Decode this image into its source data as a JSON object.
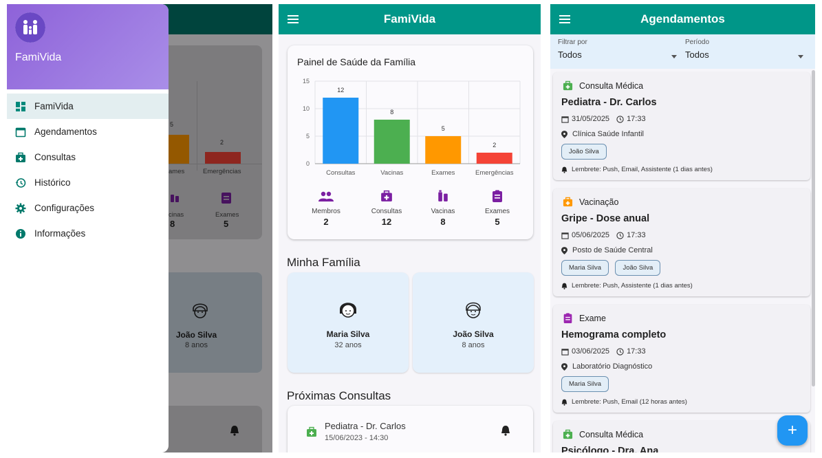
{
  "screen1": {
    "drawer": {
      "title": "FamiVida",
      "items": [
        {
          "label": "FamiVida",
          "icon": "dashboard-icon",
          "active": true
        },
        {
          "label": "Agendamentos",
          "icon": "calendar-icon"
        },
        {
          "label": "Consultas",
          "icon": "medical-bag-icon"
        },
        {
          "label": "Histórico",
          "icon": "history-icon"
        },
        {
          "label": "Configurações",
          "icon": "gear-icon"
        },
        {
          "label": "Informações",
          "icon": "info-icon"
        }
      ]
    },
    "background": {
      "bar_value_1": "5",
      "bar_value_2": "2",
      "label_1": "ames",
      "label_2": "Emergências",
      "stat_1_label": "cinas",
      "stat_1_value": "8",
      "stat_2_label": "Exames",
      "stat_2_value": "5",
      "member_name": "João Silva",
      "member_age": "8 anos"
    }
  },
  "screen2": {
    "appbar_title": "FamiVida",
    "panel": {
      "title": "Painel de Saúde da Família",
      "stats": [
        {
          "label": "Membros",
          "value": "2",
          "icon": "people-icon"
        },
        {
          "label": "Consultas",
          "value": "12",
          "icon": "medical-bag-icon"
        },
        {
          "label": "Vacinas",
          "value": "8",
          "icon": "vaccine-icon"
        },
        {
          "label": "Exames",
          "value": "5",
          "icon": "clipboard-icon"
        }
      ]
    },
    "family_title": "Minha Família",
    "members": [
      {
        "name": "Maria Silva",
        "age": "32 anos"
      },
      {
        "name": "João Silva",
        "age": "8 anos"
      }
    ],
    "next_title": "Próximas Consultas",
    "next": {
      "title": "Pediatra - Dr. Carlos",
      "datetime": "15/06/2023 - 14:30"
    }
  },
  "chart_data": {
    "type": "bar",
    "categories": [
      "Consultas",
      "Vacinas",
      "Exames",
      "Emergências"
    ],
    "values": [
      12,
      8,
      5,
      2
    ],
    "colors": [
      "#2196f3",
      "#4caf50",
      "#ff9800",
      "#f44336"
    ],
    "ylim": [
      0,
      15
    ],
    "yticks": [
      "0",
      "5",
      "10",
      "15"
    ],
    "grid": true
  },
  "screen3": {
    "appbar_title": "Agendamentos",
    "filter": {
      "label": "Filtrar por",
      "value": "Todos"
    },
    "period": {
      "label": "Período",
      "value": "Todos"
    },
    "appointments": [
      {
        "type": "Consulta Médica",
        "title": "Pediatra - Dr. Carlos",
        "date": "31/05/2025",
        "time": "17:33",
        "location": "Clínica Saúde Infantil",
        "people": [
          "João Silva"
        ],
        "reminder": "Lembrete: Push, Email, Assistente (1 dias antes)",
        "color": "#4caf50"
      },
      {
        "type": "Vacinação",
        "title": "Gripe - Dose anual",
        "date": "05/06/2025",
        "time": "17:33",
        "location": "Posto de Saúde Central",
        "people": [
          "Maria Silva",
          "João Silva"
        ],
        "reminder": "Lembrete: Push, Assistente (1 dias antes)",
        "color": "#ff9800"
      },
      {
        "type": "Exame",
        "title": "Hemograma completo",
        "date": "03/06/2025",
        "time": "17:33",
        "location": "Laboratório Diagnóstico",
        "people": [
          "Maria Silva"
        ],
        "reminder": "Lembrete: Push, Email (12 horas antes)",
        "color": "#9c27b0"
      },
      {
        "type": "Consulta Médica",
        "title": "Psicólogo - Dra. Ana",
        "color": "#4caf50"
      }
    ],
    "fab_label": "+"
  }
}
